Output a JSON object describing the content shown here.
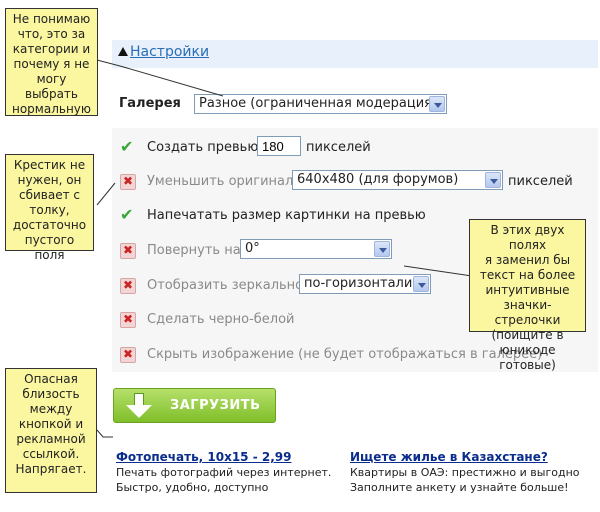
{
  "settings": {
    "link": "Настройки"
  },
  "gallery": {
    "label": "Галерея",
    "selected": "Разное (ограниченная модерация)"
  },
  "options": [
    {
      "label": "Создать превью",
      "enabled": true,
      "input_value": "180",
      "suffix": "пикселей"
    },
    {
      "label": "Уменьшить оригинал",
      "enabled": false,
      "select_value": "640x480 (для форумов)",
      "suffix": "пикселей"
    },
    {
      "label": "Напечатать размер картинки на превью",
      "enabled": true
    },
    {
      "label": "Повернуть на",
      "enabled": false,
      "select_value": "0°"
    },
    {
      "label": "Отобразить зеркально",
      "enabled": false,
      "select_value": "по-горизонтали"
    },
    {
      "label": "Сделать черно-белой",
      "enabled": false
    },
    {
      "label": "Скрыть изображение (не будет отображаться в галерее)",
      "enabled": false
    }
  ],
  "upload_button": {
    "label": "ЗАГРУЗИТЬ"
  },
  "ads": [
    {
      "title": "Фотопечать, 10x15 - 2,99",
      "line1": "Печать фотографий через интернет.",
      "line2": "Быстро, удобно, доступно"
    },
    {
      "title": "Ищете жилье в Казахстане?",
      "line1": "Квартиры в ОАЭ: престижно и выгодно",
      "line2": "Заполните анкету и узнайте больше!"
    }
  ],
  "notes": {
    "category": [
      "Не понимаю",
      "что, это за",
      "категории и",
      "почему я не",
      "могу выбрать",
      "нормальную"
    ],
    "cross": [
      "Крестик не",
      "нужен, он",
      "сбивает с",
      "толку,",
      "достаточно",
      "пустого поля"
    ],
    "arrows": [
      "В этих двух полях",
      "я заменил бы",
      "текст на более",
      "интуитивные",
      "значки-стрелочки",
      "(поищите в",
      "юникоде готовые)"
    ],
    "danger": [
      "Опасная",
      "близость",
      "между",
      "кнопкой и",
      "рекламной",
      "ссылкой.",
      "Напрягает."
    ]
  },
  "colors": {
    "note_bg": "#fbf7a0",
    "link": "#2a6fb5",
    "ad_link": "#0a2c8c",
    "button": "#7fbf2a",
    "check": "#3aa53a",
    "cross": "#cc2222"
  }
}
